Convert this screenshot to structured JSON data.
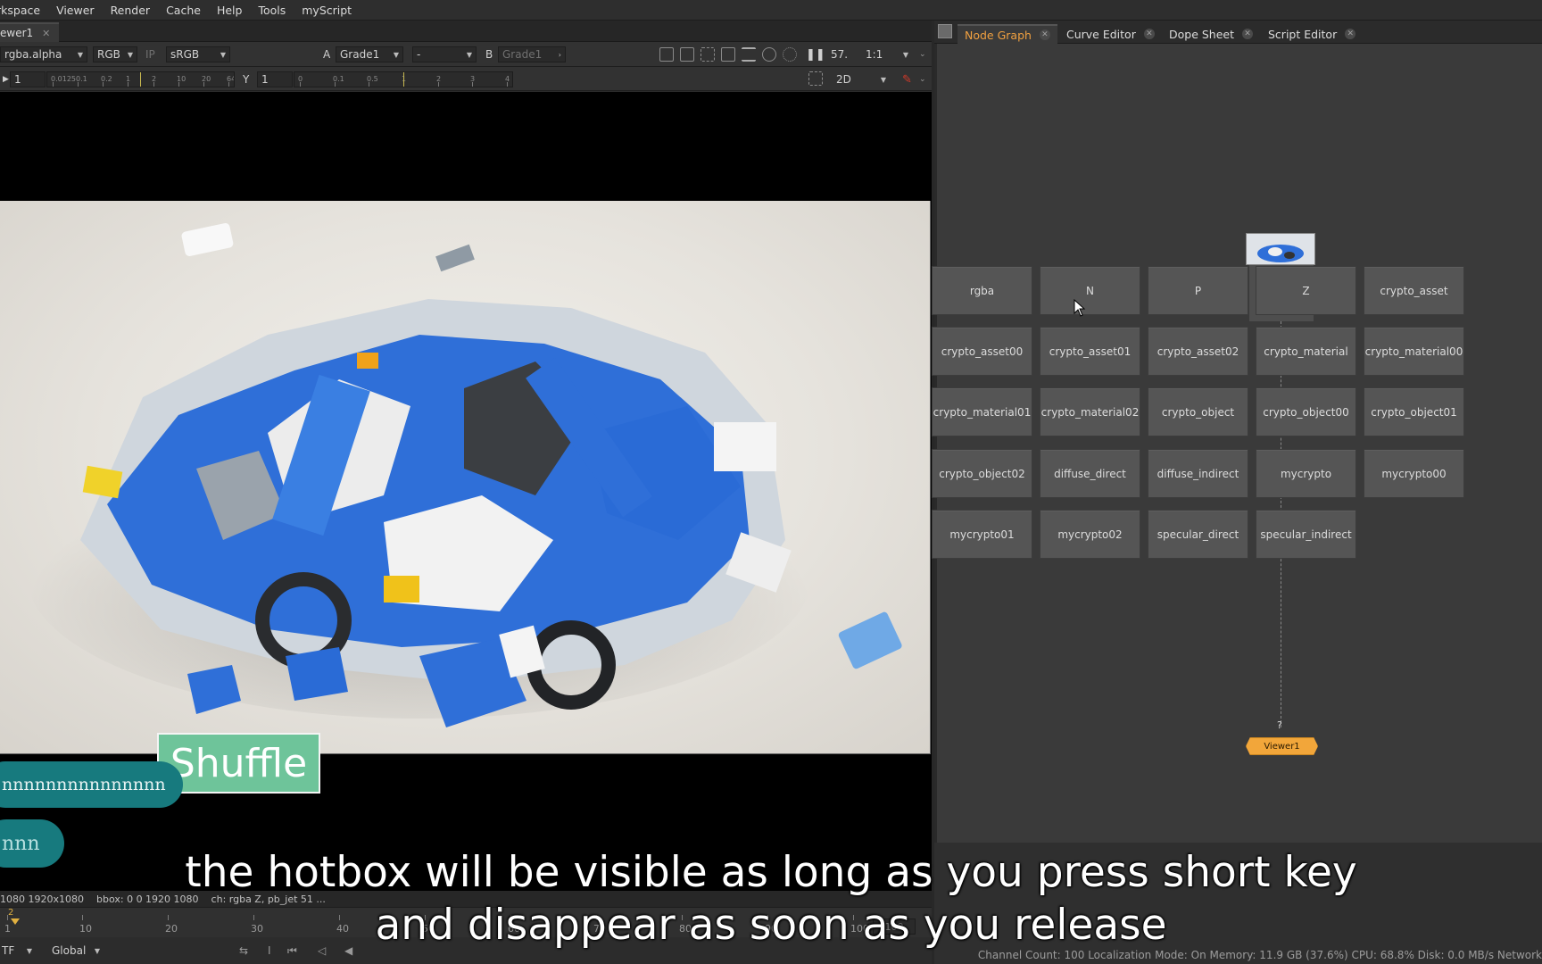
{
  "menu": [
    "rkspace",
    "Viewer",
    "Render",
    "Cache",
    "Help",
    "Tools",
    "myScript"
  ],
  "viewer": {
    "tab_label": "ewer1",
    "channel_layer": "rgba.alpha",
    "channels": "RGB",
    "ip_label": "IP",
    "lut": "sRGB",
    "a_label": "A",
    "a_input": "Grade1",
    "a_op": "-",
    "b_label": "B",
    "b_input": "Grade1",
    "zoom": "57.",
    "ratio": "1:1",
    "gain": "1",
    "gamma_label": "Y",
    "gamma": "1",
    "view_mode": "2D",
    "gain_ticks": [
      "0.0125",
      "0.1",
      "0.2",
      "1",
      "2",
      "10",
      "20",
      "64"
    ],
    "gamma_ticks": [
      "0",
      "0.1",
      "0.5",
      "1",
      "2",
      "3",
      "4"
    ]
  },
  "status_line": {
    "format": "1080 1920x1080",
    "bbox": "bbox: 0 0 1920 1080",
    "rest": "ch: rgba Z, pb_jet 51 ..."
  },
  "timeline": {
    "current_frame": "2",
    "ticks": [
      "1",
      "10",
      "20",
      "30",
      "40",
      "50",
      "60",
      "70",
      "80",
      "90",
      "100"
    ],
    "end_frame": "100",
    "tf": "TF",
    "scope": "Global"
  },
  "node_graph": {
    "tabs": [
      {
        "label": "Node Graph",
        "active": true
      },
      {
        "label": "Curve Editor",
        "active": false
      },
      {
        "label": "Dope Sheet",
        "active": false
      },
      {
        "label": "Script Editor",
        "active": false
      }
    ],
    "hotbox_buttons": [
      "rgba",
      "N",
      "P",
      "Z",
      "crypto_asset",
      "crypto_asset00",
      "crypto_asset01",
      "crypto_asset02",
      "crypto_material",
      "crypto_material00",
      "crypto_material01",
      "crypto_material02",
      "crypto_object",
      "crypto_object00",
      "crypto_object01",
      "crypto_object02",
      "diffuse_direct",
      "diffuse_indirect",
      "mycrypto",
      "mycrypto00",
      "mycrypto01",
      "mycrypto02",
      "specular_direct",
      "specular_indirect"
    ],
    "viewer_node": "Viewer1",
    "viewer_input": "?",
    "status": "Channel Count: 100  Localization Mode: On  Memory: 11.9 GB (37.6%)  CPU: 68.8%  Disk: 0.0 MB/s  Network"
  },
  "overlays": {
    "shuffle_badge": "Shuffle",
    "typed_keys": "nnnnnnnnnnnnnnn",
    "typed_keys_2": "nnn",
    "subtitle_line1": "the hotbox will be visible as long as you press short key",
    "subtitle_line2": "and disappear as soon as you release"
  },
  "colors": {
    "active_tab": "#f0a040",
    "viewer_node": "#f2a63a",
    "shuffle_badge": "#6ec49a",
    "key_pill": "#177a7e"
  }
}
